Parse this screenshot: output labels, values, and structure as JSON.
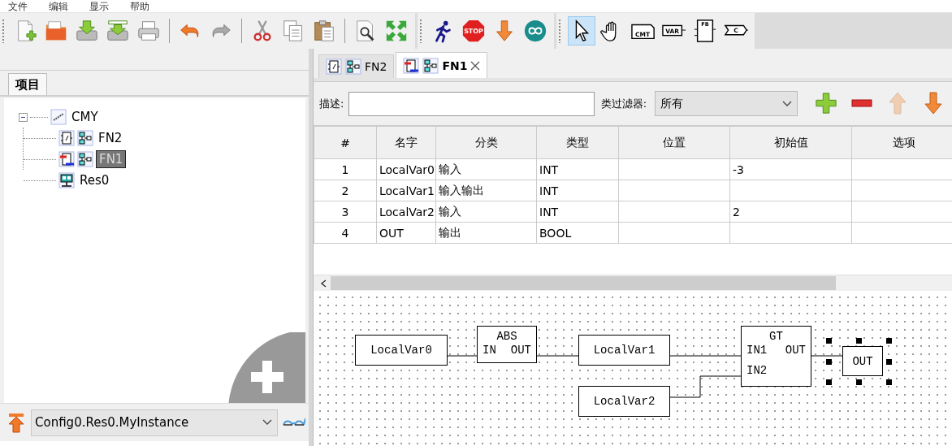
{
  "menu": [
    {
      "label": "文件"
    },
    {
      "label": "编辑"
    },
    {
      "label": "显示"
    },
    {
      "label": "帮助"
    }
  ],
  "toolbars": [
    {
      "groups": [
        [
          {
            "kind": "new"
          },
          {
            "kind": "open"
          },
          {
            "kind": "save"
          },
          {
            "kind": "save_as"
          },
          {
            "kind": "print"
          }
        ],
        [
          {
            "kind": "undo"
          },
          {
            "kind": "redo"
          }
        ],
        [
          {
            "kind": "cut"
          },
          {
            "kind": "copy"
          },
          {
            "kind": "paste"
          }
        ],
        [
          {
            "kind": "preview"
          },
          {
            "kind": "fullscreen"
          }
        ]
      ]
    },
    {
      "groups": [
        [
          {
            "kind": "run"
          },
          {
            "kind": "stop",
            "label": "STOP"
          },
          {
            "kind": "download"
          },
          {
            "kind": "board"
          }
        ]
      ]
    },
    {
      "groups": [
        [
          {
            "kind": "pointer",
            "selected": true
          },
          {
            "kind": "hand",
            "selected": false
          },
          {
            "kind": "comment",
            "label": "CMT",
            "selected": false
          },
          {
            "kind": "variable",
            "label": "VAR",
            "selected": false
          },
          {
            "kind": "block",
            "label": "FB",
            "selected": false
          },
          {
            "kind": "contact",
            "label": "C",
            "selected": false
          }
        ]
      ]
    }
  ],
  "project_tabs": [
    {
      "label": "项目",
      "selected": true
    }
  ],
  "tree": [
    {
      "label": "CMY",
      "kind": "project",
      "selected": false,
      "expanded": true,
      "children": [
        {
          "label": "FN2",
          "kind": "function",
          "selected": false
        },
        {
          "label": "FN1",
          "kind": "function_edited",
          "selected": true
        },
        {
          "label": "Res0",
          "kind": "resource",
          "selected": false
        }
      ]
    }
  ],
  "instance_bar": {
    "value": "Config0.Res0.MyInstance"
  },
  "editor_tabs": [
    {
      "label": "FN2",
      "kind": "function",
      "selected": false,
      "closable": false
    },
    {
      "label": "FN1",
      "kind": "function_edited",
      "selected": true,
      "closable": true
    }
  ],
  "filters": {
    "description_label": "描述:",
    "class_filter_label": "类过滤器:",
    "class_filter": "所有"
  },
  "var_actions": [
    {
      "kind": "add",
      "disabled": false
    },
    {
      "kind": "remove",
      "disabled": false
    },
    {
      "kind": "up",
      "disabled": true
    },
    {
      "kind": "down",
      "disabled": false
    }
  ],
  "table": {
    "columns": [
      "#",
      "名字",
      "分类",
      "类型",
      "位置",
      "初始值",
      "选项"
    ],
    "rows": [
      [
        "1",
        "LocalVar0",
        "输入",
        "INT",
        null,
        "-3",
        null
      ],
      [
        "2",
        "LocalVar1",
        "输入输出",
        "INT",
        null,
        null,
        null
      ],
      [
        "3",
        "LocalVar2",
        "输入",
        "INT",
        null,
        "2",
        null
      ],
      [
        "4",
        "OUT",
        "输出",
        "BOOL",
        null,
        null,
        null
      ]
    ]
  },
  "diagram": {
    "blocks": [
      {
        "kind": "variable",
        "label": "LocalVar0",
        "selected": false
      },
      {
        "kind": "function",
        "label": "ABS",
        "inputs": [
          "IN"
        ],
        "outputs": [
          "OUT"
        ],
        "selected": false
      },
      {
        "kind": "variable",
        "label": "LocalVar1",
        "selected": false
      },
      {
        "kind": "function",
        "label": "GT",
        "inputs": [
          "IN1",
          "IN2"
        ],
        "outputs": [
          "OUT"
        ],
        "selected": false
      },
      {
        "kind": "variable",
        "label": "OUT",
        "selected": true
      },
      {
        "kind": "variable",
        "label": "LocalVar2",
        "selected": false
      }
    ]
  }
}
